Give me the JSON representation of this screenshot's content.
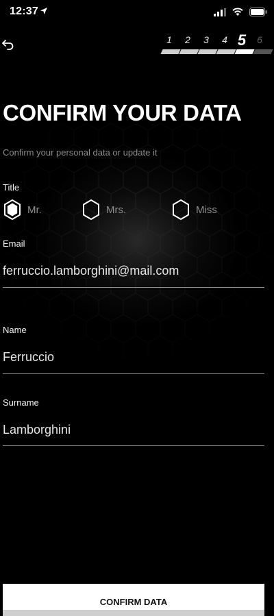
{
  "status_bar": {
    "time": "12:37"
  },
  "steps": {
    "items": [
      "1",
      "2",
      "3",
      "4",
      "5",
      "6"
    ],
    "current": 5
  },
  "header": {
    "title": "CONFIRM YOUR DATA",
    "subtitle": "Confirm your personal data or update it"
  },
  "form": {
    "title_label": "Title",
    "title_options": [
      "Mr.",
      "Mrs.",
      "Miss"
    ],
    "title_selected": "Mr.",
    "email_label": "Email",
    "email_value": "ferruccio.lamborghini@mail.com",
    "name_label": "Name",
    "name_value": "Ferruccio",
    "surname_label": "Surname",
    "surname_value": "Lamborghini"
  },
  "actions": {
    "confirm_label": "CONFIRM DATA"
  },
  "icons": {
    "back": "back-arrow-icon",
    "location": "location-arrow-icon",
    "signal": "cellular-signal-icon",
    "wifi": "wifi-icon",
    "battery": "battery-icon",
    "radio": "hexagon-radio-icon"
  },
  "colors": {
    "background": "#000000",
    "text": "#ffffff",
    "muted": "#8c8c8c",
    "button": "#ffffff"
  }
}
